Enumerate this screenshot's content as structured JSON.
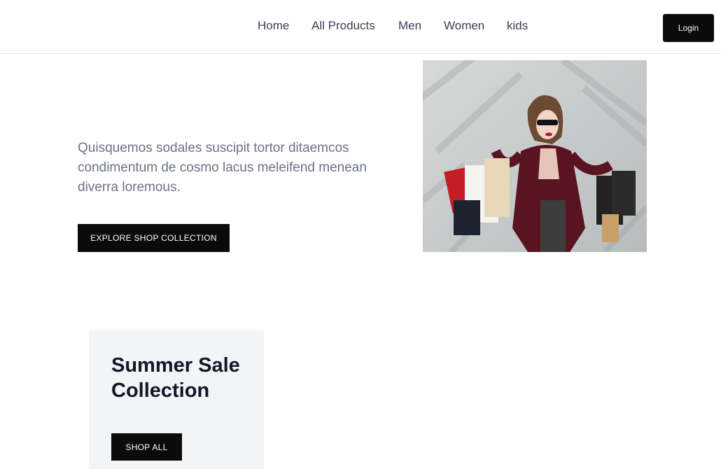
{
  "nav": {
    "items": [
      {
        "label": "Home"
      },
      {
        "label": "All Products"
      },
      {
        "label": "Men"
      },
      {
        "label": "Women"
      },
      {
        "label": "kids"
      }
    ],
    "login_label": "Login"
  },
  "hero": {
    "text": "Quisquemos sodales suscipit tortor ditaemcos condimentum de cosmo lacus meleifend menean diverra loremous.",
    "cta_label": "EXPLORE SHOP COLLECTION"
  },
  "promo": {
    "title": "Summer Sale Collection",
    "cta_label": "SHOP ALL"
  },
  "colors": {
    "primary_button": "#0b0b0b",
    "card_bg": "#f3f4f6",
    "body_text": "#6b7280"
  }
}
